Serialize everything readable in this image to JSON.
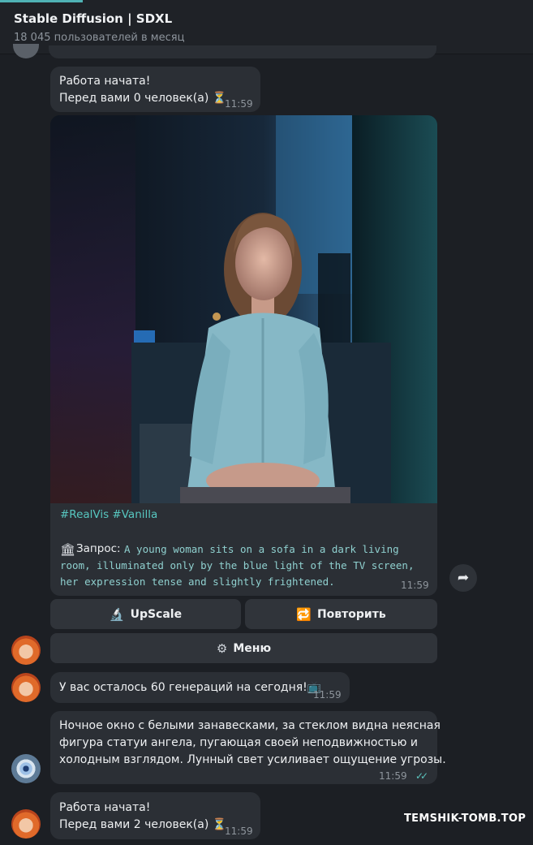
{
  "header": {
    "title": "Stable Diffusion | SDXL",
    "subtitle": "18 045 пользователей в месяц"
  },
  "messages": {
    "started_1": {
      "line1": "Работа начата!",
      "line2": "Перед вами 0 человек(а)",
      "time": "11:59"
    },
    "image_caption": {
      "tags": "#RealVis #Vanilla",
      "request_label": "Запрос:",
      "request_lines": [
        "A young woman sits on a sofa in a dark living",
        "room, illuminated only by the blue light of the TV screen,",
        "her expression tense and slightly frightened."
      ],
      "time": "11:59"
    },
    "keyboard": {
      "upscale_label": "UpScale",
      "repeat_label": "Повторить",
      "menu_label": "Меню"
    },
    "remaining": {
      "text": "У вас осталось 60 генераций на сегодня!",
      "time": "11:59"
    },
    "user_prompt": {
      "lines": [
        "Ночное окно с белыми занавесками, за стеклом видна неясная",
        "фигура статуи ангела, пугающая своей неподвижностью и",
        "холодным взглядом. Лунный свет усиливает ощущение угрозы."
      ],
      "time": "11:59"
    },
    "started_2": {
      "line1": "Работа начата!",
      "line2": "Перед вами 2 человек(а)",
      "time": "11:59"
    }
  },
  "icons": {
    "hourglass": "⏳",
    "forward": "➦",
    "microscope": "🔬",
    "repeat": "🔁",
    "gear": "⚙",
    "bank": "🏛",
    "tv": "📺",
    "double_check": "✓✓"
  },
  "watermark": "TEMSHIK-TOMB.TOP",
  "colors": {
    "background": "#1c1f24",
    "bubble": "#2b2f35",
    "accent": "#4fb2b5",
    "tag": "#57c7c0"
  }
}
